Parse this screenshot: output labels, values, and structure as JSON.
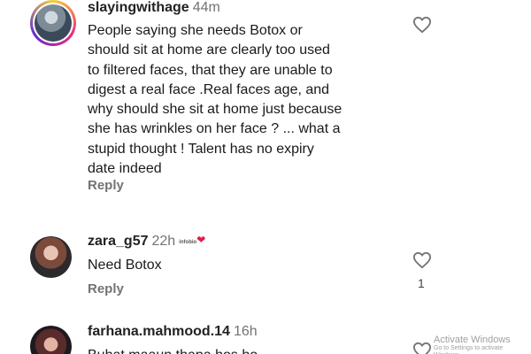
{
  "comments": [
    {
      "username": "slayingwithage",
      "time": "44m",
      "text_lines": [
        "People saying she needs Botox or",
        "should sit at home are clearly too used",
        "to filtered faces, that they are unable to",
        "digest a real face .Real faces age, and",
        "why should she sit at home just because",
        "she has wrinkles on her face ? ...  what a",
        "stupid thought ! Talent has no expiry",
        "date indeed"
      ],
      "reply_label": "Reply",
      "like_icon": "heart-outline-icon",
      "has_story_ring": true
    },
    {
      "username": "zara_g57",
      "time": "22h",
      "badge_text": "infobio",
      "badge_heart": "❤",
      "text_lines": [
        "Need Botox"
      ],
      "reply_label": "Reply",
      "like_icon": "heart-outline-icon",
      "like_count": "1"
    },
    {
      "username": "farhana.mahmood.14",
      "time": "16h",
      "text_lines": [
        "Buhat maaun thapa hos ho"
      ],
      "like_icon": "heart-outline-icon"
    }
  ],
  "watermark": {
    "title": "Activate Windows",
    "subtitle": "Go to Settings to activate Windows."
  },
  "colors": {
    "text": "#1a1a1a",
    "muted": "#737373",
    "heart": "#e11d48"
  }
}
